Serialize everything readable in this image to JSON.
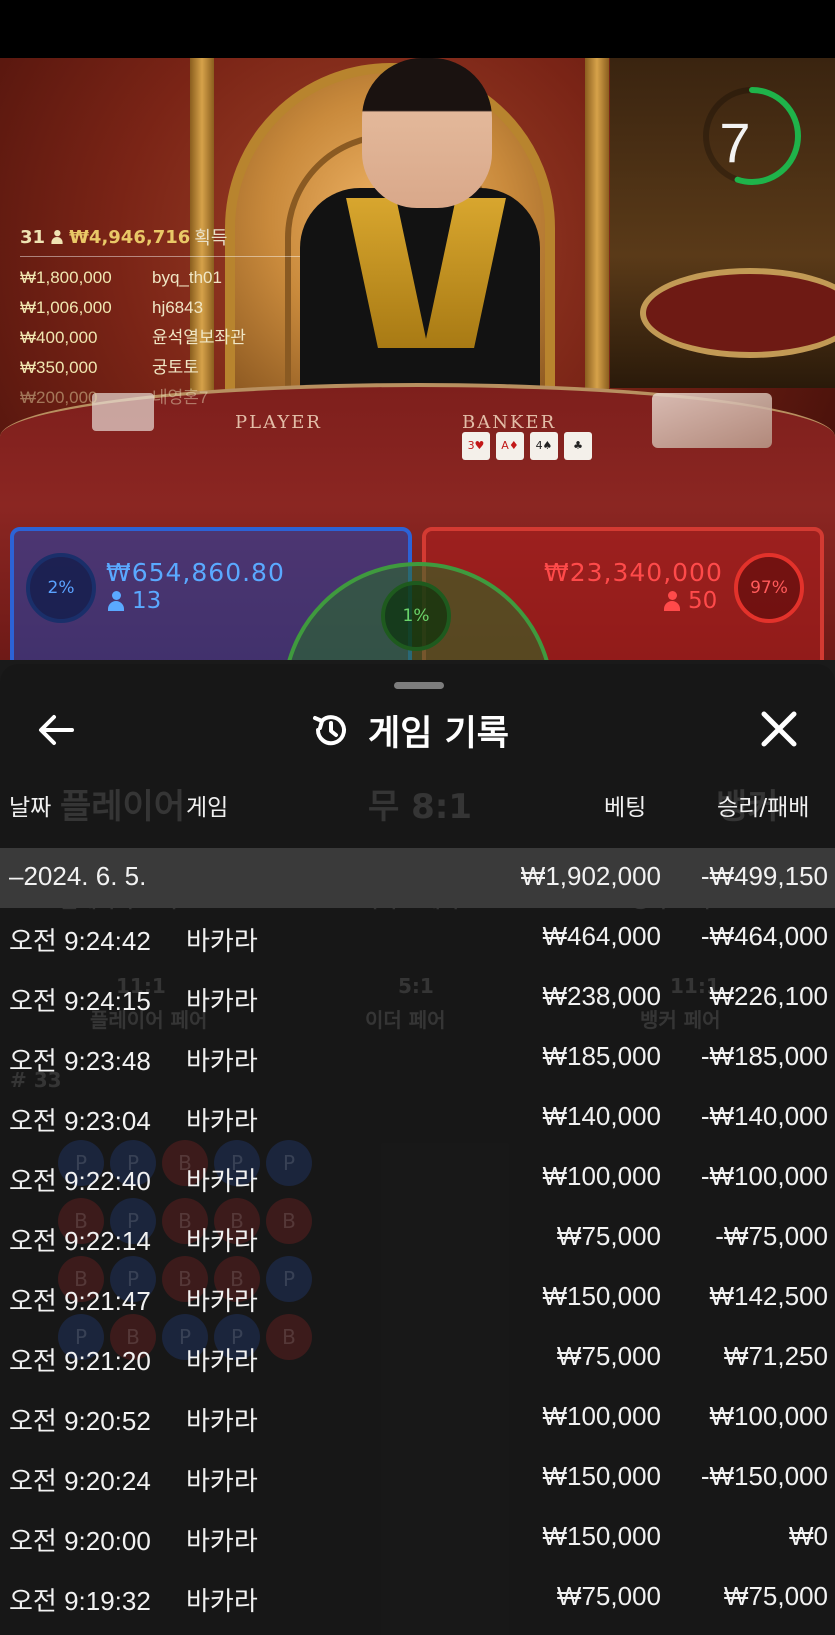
{
  "timer": {
    "value": "7"
  },
  "table_labels": {
    "player": "PLAYER",
    "banker": "BANKER"
  },
  "winners": {
    "count": "31",
    "total": "₩4,946,716",
    "label": "획득",
    "rows": [
      {
        "amount": "₩1,800,000",
        "name": "byq_th01"
      },
      {
        "amount": "₩1,006,000",
        "name": "hj6843"
      },
      {
        "amount": "₩400,000",
        "name": "윤석열보좌관"
      },
      {
        "amount": "₩350,000",
        "name": "궁토토"
      },
      {
        "amount": "₩200,000",
        "name": "내영혼7"
      }
    ]
  },
  "betting": {
    "player": {
      "pct": "2%",
      "pool": "₩654,860.80",
      "players": "13",
      "color": "#2c63d6"
    },
    "tie": {
      "pct": "1%",
      "color": "#3f9a3e"
    },
    "banker": {
      "pct": "97%",
      "pool": "₩23,340,000",
      "players": "50",
      "color": "#d33a32"
    }
  },
  "history": {
    "title": "게임 기록",
    "columns": {
      "date": "날짜",
      "game": "게임",
      "bet": "베팅",
      "result": "승리/패배"
    },
    "summary": {
      "date": "–2024. 6. 5.",
      "bet": "₩1,902,000",
      "result": "-₩499,150"
    },
    "rows": [
      {
        "time": "오전 9:24:42",
        "game": "바카라",
        "bet": "₩464,000",
        "result": "-₩464,000"
      },
      {
        "time": "오전 9:24:15",
        "game": "바카라",
        "bet": "₩238,000",
        "result": "₩226,100"
      },
      {
        "time": "오전 9:23:48",
        "game": "바카라",
        "bet": "₩185,000",
        "result": "-₩185,000"
      },
      {
        "time": "오전 9:23:04",
        "game": "바카라",
        "bet": "₩140,000",
        "result": "-₩140,000"
      },
      {
        "time": "오전 9:22:40",
        "game": "바카라",
        "bet": "₩100,000",
        "result": "-₩100,000"
      },
      {
        "time": "오전 9:22:14",
        "game": "바카라",
        "bet": "₩75,000",
        "result": "-₩75,000"
      },
      {
        "time": "오전 9:21:47",
        "game": "바카라",
        "bet": "₩150,000",
        "result": "₩142,500"
      },
      {
        "time": "오전 9:21:20",
        "game": "바카라",
        "bet": "₩75,000",
        "result": "₩71,250"
      },
      {
        "time": "오전 9:20:52",
        "game": "바카라",
        "bet": "₩100,000",
        "result": "₩100,000"
      },
      {
        "time": "오전 9:20:24",
        "game": "바카라",
        "bet": "₩150,000",
        "result": "-₩150,000"
      },
      {
        "time": "오전 9:20:00",
        "game": "바카라",
        "bet": "₩150,000",
        "result": "₩0"
      },
      {
        "time": "오전 9:19:32",
        "game": "바카라",
        "bet": "₩75,000",
        "result": "₩75,000"
      }
    ]
  },
  "background_ghost": {
    "player_label": "플레이어",
    "tie_label": "무 8:1",
    "banker_label": "뱅커",
    "player_bonus": "플레이어 보너스",
    "perfect_pair": "퍼펙트 페어",
    "either_pair": "이더 페어",
    "banker_bonus": "뱅커 보너스",
    "player_pair": "플레이어 페어",
    "banker_pair": "뱅커 페어",
    "pay_11_1": "11:1",
    "pay_5_1": "5:1",
    "round": "# 33"
  }
}
